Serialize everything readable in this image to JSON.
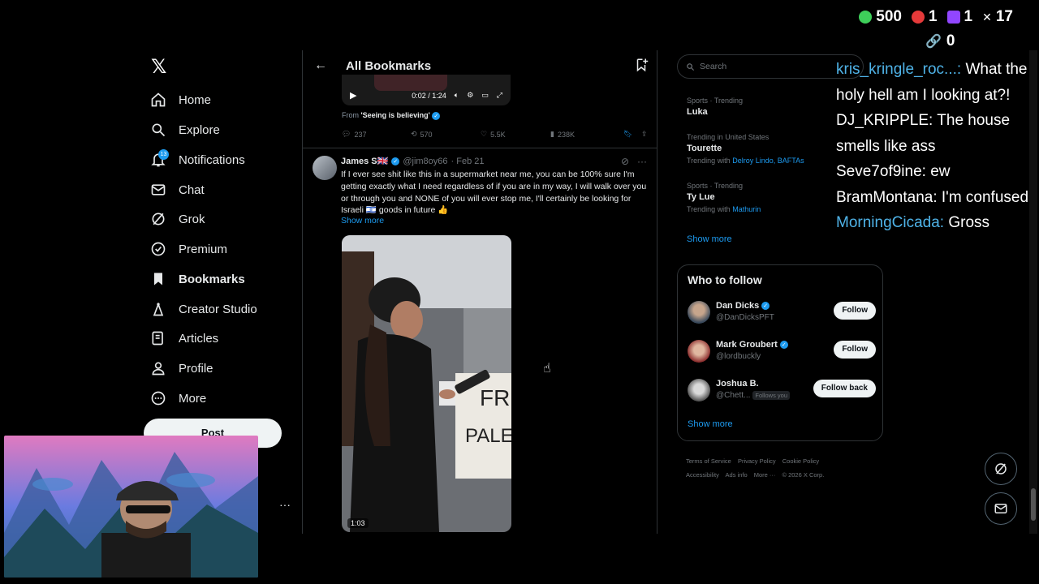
{
  "overlay": {
    "views": "500",
    "stat2": "1",
    "stat3": "1",
    "x_count": "17",
    "links": "0"
  },
  "chat": [
    {
      "user": "kris_kringle_roc...:",
      "msg": "What the holy hell am I looking at?!"
    },
    {
      "user": "DJ_KRIPPLE:",
      "msg": "The house smells like ass"
    },
    {
      "user": "Seve7of9ine:",
      "msg": "ew"
    },
    {
      "user": "BramMontana:",
      "msg": "I'm confused"
    },
    {
      "user": "MorningCicada:",
      "msg": "Gross"
    }
  ],
  "nav": {
    "logo": "𝕏",
    "items": [
      {
        "label": "Home"
      },
      {
        "label": "Explore"
      },
      {
        "label": "Notifications"
      },
      {
        "label": "Chat"
      },
      {
        "label": "Grok"
      },
      {
        "label": "Premium"
      },
      {
        "label": "Bookmarks"
      },
      {
        "label": "Creator Studio"
      },
      {
        "label": "Articles"
      },
      {
        "label": "Profile"
      },
      {
        "label": "More"
      }
    ],
    "notif_badge": "13",
    "post": "Post",
    "more_dots": "···"
  },
  "main": {
    "title": "All Bookmarks",
    "video1": {
      "time": "0:02 / 1:24"
    },
    "from_prefix": "From ",
    "from_name": "'Seeing is believing'",
    "actions": {
      "replies": "237",
      "reposts": "570",
      "likes": "5.5K",
      "views": "238K"
    },
    "tweet": {
      "name": "James S🇬🇧",
      "handle": "@jim8oy66",
      "date": "· Feb 21",
      "text": "If I ever see shit like this in a supermarket near me, you can be 100% sure I'm getting exactly what I need regardless of if you are in my way, I will walk over you or through you and NONE of you will ever stop me, I'll certainly be looking for Israeli 🇮🇱 goods in future 👍",
      "show_more": "Show more",
      "video_duration": "1:03"
    }
  },
  "right": {
    "search_placeholder": "Search",
    "trends": [
      {
        "cat": "Sports · Trending",
        "title": "Luka",
        "with": ""
      },
      {
        "cat": "Trending in United States",
        "title": "Tourette",
        "with_prefix": "Trending with",
        "with": "Delroy Lindo, BAFTAs"
      },
      {
        "cat": "Sports · Trending",
        "title": "Ty Lue",
        "with_prefix": "Trending with",
        "with": "Mathurin"
      }
    ],
    "show_more": "Show more",
    "who_to_follow": {
      "title": "Who to follow",
      "people": [
        {
          "name": "Dan Dicks",
          "handle": "@DanDicksPFT",
          "button": "Follow"
        },
        {
          "name": "Mark Groubert",
          "handle": "@lordbuckly",
          "button": "Follow"
        },
        {
          "name": "Joshua B.",
          "handle": "@Chett...",
          "follows_you": "Follows you",
          "button": "Follow back"
        }
      ],
      "show_more": "Show more"
    },
    "footer": {
      "line1": [
        "Terms of Service",
        "Privacy Policy",
        "Cookie Policy"
      ],
      "line2": [
        "Accessibility",
        "Ads info",
        "More ···",
        "© 2026 X Corp."
      ]
    }
  }
}
